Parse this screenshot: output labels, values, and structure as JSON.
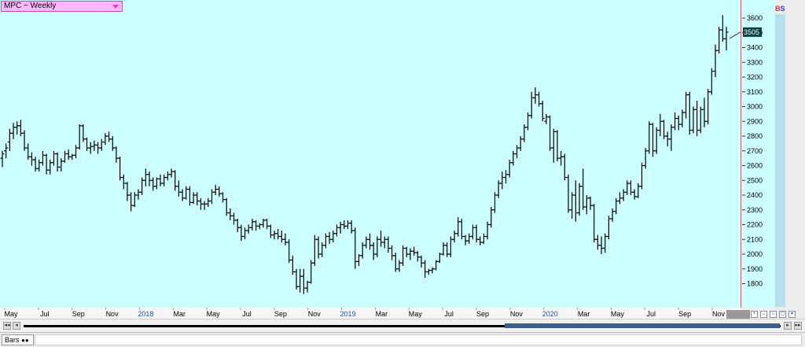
{
  "title_box": {
    "label": "MPC ~ Weekly"
  },
  "side_labels": {
    "b": "B",
    "s": "S"
  },
  "status": {
    "tab_label": "Bars"
  },
  "colors": {
    "plot_bg": "#ccffff",
    "bar": "#000000",
    "year_tick": "#1a4ec8",
    "price_tag_bg": "#004040"
  },
  "chart_data": {
    "type": "ohlc",
    "title": "MPC ~ Weekly",
    "ylim": [
      1680,
      3680
    ],
    "yticks": [
      1800,
      1900,
      2000,
      2100,
      2200,
      2300,
      2400,
      2500,
      2600,
      2700,
      2800,
      2900,
      3000,
      3100,
      3200,
      3300,
      3400,
      3500,
      3600
    ],
    "last_price_label": "3505",
    "last_price": 3505,
    "x_ticks": [
      {
        "label": "May",
        "year": false
      },
      {
        "label": "Jul",
        "year": false
      },
      {
        "label": "Sep",
        "year": false
      },
      {
        "label": "Nov",
        "year": false
      },
      {
        "label": "2018",
        "year": true
      },
      {
        "label": "Mar",
        "year": false
      },
      {
        "label": "May",
        "year": false
      },
      {
        "label": "Jul",
        "year": false
      },
      {
        "label": "Sep",
        "year": false
      },
      {
        "label": "Nov",
        "year": false
      },
      {
        "label": "2019",
        "year": true
      },
      {
        "label": "Mar",
        "year": false
      },
      {
        "label": "May",
        "year": false
      },
      {
        "label": "Jul",
        "year": false
      },
      {
        "label": "Sep",
        "year": false
      },
      {
        "label": "Nov",
        "year": false
      },
      {
        "label": "2020",
        "year": true
      },
      {
        "label": "Mar",
        "year": false
      },
      {
        "label": "May",
        "year": false
      },
      {
        "label": "Jul",
        "year": false
      },
      {
        "label": "Sep",
        "year": false
      },
      {
        "label": "Nov",
        "year": false
      }
    ],
    "bars": [
      [
        2650,
        2700,
        2590,
        2680
      ],
      [
        2700,
        2750,
        2650,
        2720
      ],
      [
        2760,
        2850,
        2700,
        2820
      ],
      [
        2820,
        2890,
        2780,
        2860
      ],
      [
        2860,
        2900,
        2810,
        2870
      ],
      [
        2870,
        2910,
        2800,
        2820
      ],
      [
        2820,
        2840,
        2700,
        2720
      ],
      [
        2720,
        2750,
        2640,
        2660
      ],
      [
        2660,
        2690,
        2600,
        2640
      ],
      [
        2640,
        2660,
        2560,
        2580
      ],
      [
        2580,
        2640,
        2560,
        2620
      ],
      [
        2620,
        2700,
        2600,
        2670
      ],
      [
        2670,
        2680,
        2540,
        2570
      ],
      [
        2570,
        2640,
        2540,
        2620
      ],
      [
        2620,
        2700,
        2600,
        2680
      ],
      [
        2680,
        2690,
        2560,
        2590
      ],
      [
        2590,
        2650,
        2560,
        2630
      ],
      [
        2630,
        2700,
        2620,
        2680
      ],
      [
        2680,
        2710,
        2640,
        2660
      ],
      [
        2660,
        2680,
        2640,
        2670
      ],
      [
        2670,
        2740,
        2650,
        2720
      ],
      [
        2720,
        2880,
        2710,
        2870
      ],
      [
        2870,
        2880,
        2760,
        2780
      ],
      [
        2780,
        2790,
        2700,
        2720
      ],
      [
        2720,
        2760,
        2680,
        2730
      ],
      [
        2730,
        2770,
        2700,
        2740
      ],
      [
        2740,
        2760,
        2680,
        2720
      ],
      [
        2720,
        2780,
        2700,
        2760
      ],
      [
        2760,
        2820,
        2740,
        2800
      ],
      [
        2800,
        2830,
        2760,
        2780
      ],
      [
        2780,
        2800,
        2700,
        2720
      ],
      [
        2720,
        2730,
        2620,
        2650
      ],
      [
        2650,
        2660,
        2500,
        2520
      ],
      [
        2520,
        2540,
        2440,
        2480
      ],
      [
        2480,
        2490,
        2360,
        2400
      ],
      [
        2400,
        2420,
        2290,
        2330
      ],
      [
        2330,
        2420,
        2320,
        2400
      ],
      [
        2400,
        2440,
        2370,
        2420
      ],
      [
        2420,
        2520,
        2400,
        2500
      ],
      [
        2500,
        2580,
        2460,
        2540
      ],
      [
        2540,
        2560,
        2460,
        2500
      ],
      [
        2500,
        2520,
        2430,
        2460
      ],
      [
        2460,
        2520,
        2440,
        2510
      ],
      [
        2510,
        2540,
        2460,
        2480
      ],
      [
        2480,
        2540,
        2460,
        2520
      ],
      [
        2520,
        2560,
        2500,
        2540
      ],
      [
        2540,
        2580,
        2520,
        2560
      ],
      [
        2560,
        2570,
        2430,
        2460
      ],
      [
        2460,
        2500,
        2390,
        2420
      ],
      [
        2420,
        2440,
        2360,
        2380
      ],
      [
        2380,
        2460,
        2370,
        2440
      ],
      [
        2440,
        2460,
        2330,
        2350
      ],
      [
        2350,
        2420,
        2340,
        2400
      ],
      [
        2400,
        2420,
        2330,
        2360
      ],
      [
        2360,
        2380,
        2300,
        2340
      ],
      [
        2340,
        2360,
        2300,
        2340
      ],
      [
        2340,
        2380,
        2320,
        2360
      ],
      [
        2360,
        2440,
        2340,
        2420
      ],
      [
        2420,
        2470,
        2400,
        2440
      ],
      [
        2440,
        2460,
        2390,
        2410
      ],
      [
        2410,
        2420,
        2350,
        2370
      ],
      [
        2370,
        2380,
        2260,
        2280
      ],
      [
        2280,
        2310,
        2230,
        2260
      ],
      [
        2260,
        2280,
        2200,
        2230
      ],
      [
        2230,
        2240,
        2150,
        2180
      ],
      [
        2180,
        2200,
        2090,
        2120
      ],
      [
        2120,
        2180,
        2100,
        2160
      ],
      [
        2160,
        2200,
        2140,
        2180
      ],
      [
        2180,
        2240,
        2160,
        2220
      ],
      [
        2220,
        2230,
        2160,
        2190
      ],
      [
        2190,
        2210,
        2170,
        2200
      ],
      [
        2200,
        2240,
        2180,
        2230
      ],
      [
        2230,
        2240,
        2170,
        2190
      ],
      [
        2190,
        2200,
        2110,
        2130
      ],
      [
        2130,
        2160,
        2100,
        2140
      ],
      [
        2140,
        2170,
        2100,
        2120
      ],
      [
        2120,
        2160,
        2080,
        2100
      ],
      [
        2100,
        2140,
        2060,
        2080
      ],
      [
        2080,
        2100,
        1940,
        1960
      ],
      [
        1960,
        1990,
        1860,
        1880
      ],
      [
        1880,
        1900,
        1760,
        1780
      ],
      [
        1780,
        1900,
        1740,
        1850
      ],
      [
        1850,
        1900,
        1730,
        1770
      ],
      [
        1770,
        1820,
        1740,
        1810
      ],
      [
        1810,
        1960,
        1800,
        1940
      ],
      [
        1940,
        2130,
        1920,
        2100
      ],
      [
        2100,
        2120,
        1970,
        2000
      ],
      [
        2000,
        2080,
        1980,
        2060
      ],
      [
        2060,
        2140,
        2040,
        2120
      ],
      [
        2120,
        2150,
        2070,
        2100
      ],
      [
        2100,
        2160,
        2080,
        2140
      ],
      [
        2140,
        2200,
        2120,
        2180
      ],
      [
        2180,
        2220,
        2140,
        2200
      ],
      [
        2200,
        2230,
        2170,
        2190
      ],
      [
        2190,
        2230,
        2170,
        2210
      ],
      [
        2210,
        2230,
        2140,
        2160
      ],
      [
        2160,
        2180,
        1900,
        1950
      ],
      [
        1950,
        2000,
        1920,
        1990
      ],
      [
        1990,
        2080,
        1970,
        2060
      ],
      [
        2060,
        2120,
        2040,
        2100
      ],
      [
        2100,
        2140,
        2030,
        2060
      ],
      [
        2060,
        2080,
        1960,
        2000
      ],
      [
        2000,
        2120,
        1980,
        2100
      ],
      [
        2100,
        2160,
        2050,
        2080
      ],
      [
        2080,
        2120,
        2040,
        2100
      ],
      [
        2100,
        2120,
        2010,
        2040
      ],
      [
        2040,
        2060,
        1960,
        1990
      ],
      [
        1990,
        2010,
        1880,
        1900
      ],
      [
        1900,
        1960,
        1880,
        1940
      ],
      [
        1940,
        2060,
        1920,
        2040
      ],
      [
        2040,
        2050,
        1980,
        2000
      ],
      [
        2000,
        2040,
        1960,
        2020
      ],
      [
        2020,
        2050,
        1990,
        2010
      ],
      [
        2010,
        2020,
        1950,
        1980
      ],
      [
        1980,
        1990,
        1910,
        1940
      ],
      [
        1940,
        1960,
        1840,
        1880
      ],
      [
        1880,
        1900,
        1860,
        1890
      ],
      [
        1890,
        1910,
        1870,
        1900
      ],
      [
        1900,
        1960,
        1890,
        1950
      ],
      [
        1950,
        2010,
        1940,
        2000
      ],
      [
        2000,
        2080,
        1990,
        2060
      ],
      [
        2060,
        2080,
        1980,
        2000
      ],
      [
        2000,
        2120,
        1980,
        2100
      ],
      [
        2100,
        2160,
        2080,
        2140
      ],
      [
        2140,
        2250,
        2120,
        2220
      ],
      [
        2220,
        2240,
        2100,
        2120
      ],
      [
        2120,
        2130,
        2060,
        2090
      ],
      [
        2090,
        2140,
        2070,
        2120
      ],
      [
        2120,
        2200,
        2100,
        2180
      ],
      [
        2180,
        2200,
        2080,
        2100
      ],
      [
        2100,
        2120,
        2060,
        2080
      ],
      [
        2080,
        2140,
        2070,
        2120
      ],
      [
        2120,
        2220,
        2100,
        2200
      ],
      [
        2200,
        2320,
        2180,
        2300
      ],
      [
        2300,
        2420,
        2280,
        2400
      ],
      [
        2400,
        2500,
        2380,
        2480
      ],
      [
        2480,
        2560,
        2440,
        2520
      ],
      [
        2520,
        2570,
        2480,
        2540
      ],
      [
        2540,
        2640,
        2520,
        2620
      ],
      [
        2620,
        2700,
        2600,
        2680
      ],
      [
        2680,
        2740,
        2650,
        2720
      ],
      [
        2720,
        2800,
        2700,
        2780
      ],
      [
        2780,
        2880,
        2760,
        2860
      ],
      [
        2860,
        2960,
        2840,
        2940
      ],
      [
        2940,
        3100,
        2920,
        3060
      ],
      [
        3060,
        3130,
        3020,
        3080
      ],
      [
        3080,
        3100,
        3000,
        3020
      ],
      [
        3020,
        3040,
        2900,
        2920
      ],
      [
        2900,
        2950,
        2880,
        2930
      ],
      [
        2930,
        2940,
        2700,
        2720
      ],
      [
        2720,
        2850,
        2620,
        2830
      ],
      [
        2830,
        2840,
        2630,
        2650
      ],
      [
        2650,
        2700,
        2600,
        2660
      ],
      [
        2660,
        2680,
        2500,
        2520
      ],
      [
        2520,
        2540,
        2280,
        2300
      ],
      [
        2300,
        2420,
        2240,
        2400
      ],
      [
        2400,
        2500,
        2220,
        2280
      ],
      [
        2280,
        2480,
        2260,
        2460
      ],
      [
        2460,
        2580,
        2300,
        2320
      ],
      [
        2320,
        2400,
        2270,
        2380
      ],
      [
        2380,
        2390,
        2300,
        2330
      ],
      [
        2330,
        2340,
        2080,
        2100
      ],
      [
        2100,
        2130,
        2030,
        2060
      ],
      [
        2060,
        2120,
        2000,
        2040
      ],
      [
        2040,
        2140,
        2010,
        2120
      ],
      [
        2120,
        2260,
        2100,
        2240
      ],
      [
        2240,
        2310,
        2220,
        2290
      ],
      [
        2290,
        2380,
        2270,
        2360
      ],
      [
        2360,
        2420,
        2340,
        2380
      ],
      [
        2380,
        2440,
        2360,
        2420
      ],
      [
        2420,
        2500,
        2400,
        2480
      ],
      [
        2480,
        2500,
        2400,
        2420
      ],
      [
        2420,
        2440,
        2370,
        2390
      ],
      [
        2390,
        2480,
        2380,
        2460
      ],
      [
        2460,
        2620,
        2440,
        2600
      ],
      [
        2600,
        2720,
        2580,
        2700
      ],
      [
        2700,
        2900,
        2680,
        2880
      ],
      [
        2880,
        2890,
        2660,
        2700
      ],
      [
        2700,
        2860,
        2680,
        2840
      ],
      [
        2840,
        2950,
        2800,
        2900
      ],
      [
        2900,
        2910,
        2780,
        2800
      ],
      [
        2800,
        2830,
        2730,
        2780
      ],
      [
        2780,
        2880,
        2700,
        2860
      ],
      [
        2860,
        2960,
        2840,
        2920
      ],
      [
        2920,
        2940,
        2840,
        2880
      ],
      [
        2880,
        2980,
        2860,
        2960
      ],
      [
        2960,
        3100,
        2920,
        3080
      ],
      [
        3080,
        3100,
        2810,
        2840
      ],
      [
        2840,
        3000,
        2820,
        2980
      ],
      [
        2980,
        3040,
        2800,
        2840
      ],
      [
        2840,
        3000,
        2820,
        2980
      ],
      [
        2980,
        3060,
        2860,
        2900
      ],
      [
        2900,
        3120,
        2880,
        3100
      ],
      [
        3100,
        3260,
        3080,
        3240
      ],
      [
        3240,
        3420,
        3200,
        3380
      ],
      [
        3380,
        3540,
        3360,
        3520
      ],
      [
        3520,
        3620,
        3440,
        3460
      ],
      [
        3460,
        3540,
        3380,
        3505
      ]
    ]
  }
}
